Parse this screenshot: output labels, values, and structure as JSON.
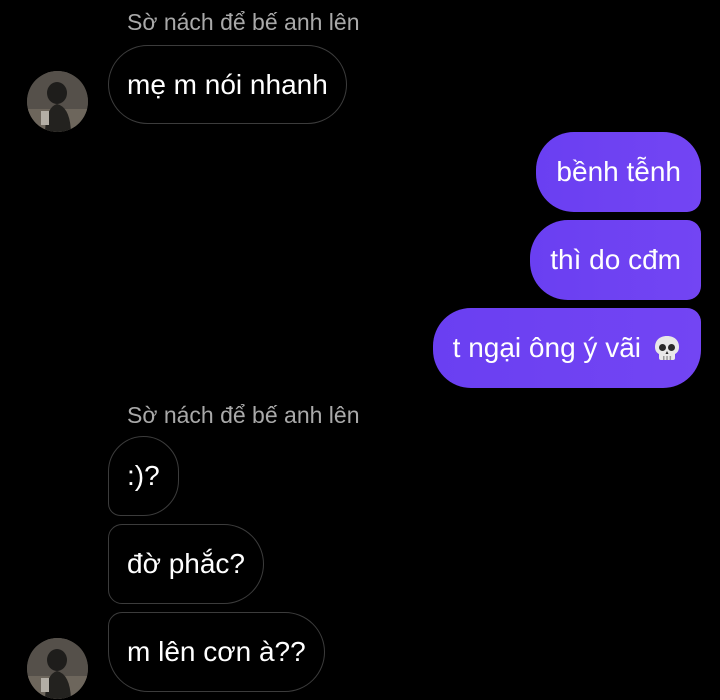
{
  "conversation": {
    "contact_name": "Sờ nách để bế anh lên",
    "messages": [
      {
        "direction": "in",
        "text": "mẹ m nói nhanh"
      },
      {
        "direction": "out",
        "text": "bềnh tễnh"
      },
      {
        "direction": "out",
        "text": "thì do cđm"
      },
      {
        "direction": "out",
        "text": "t ngại ông ý vãi",
        "emoji": "skull-icon"
      },
      {
        "direction": "in",
        "text": ":)?"
      },
      {
        "direction": "in",
        "text": "đờ phắc?"
      },
      {
        "direction": "in",
        "text": "m lên cơn à??"
      }
    ]
  },
  "colors": {
    "background": "#000000",
    "outgoing_bubble": "#6c40f2",
    "incoming_border": "#3c3c3c",
    "sender_name": "#a9a9a9"
  }
}
